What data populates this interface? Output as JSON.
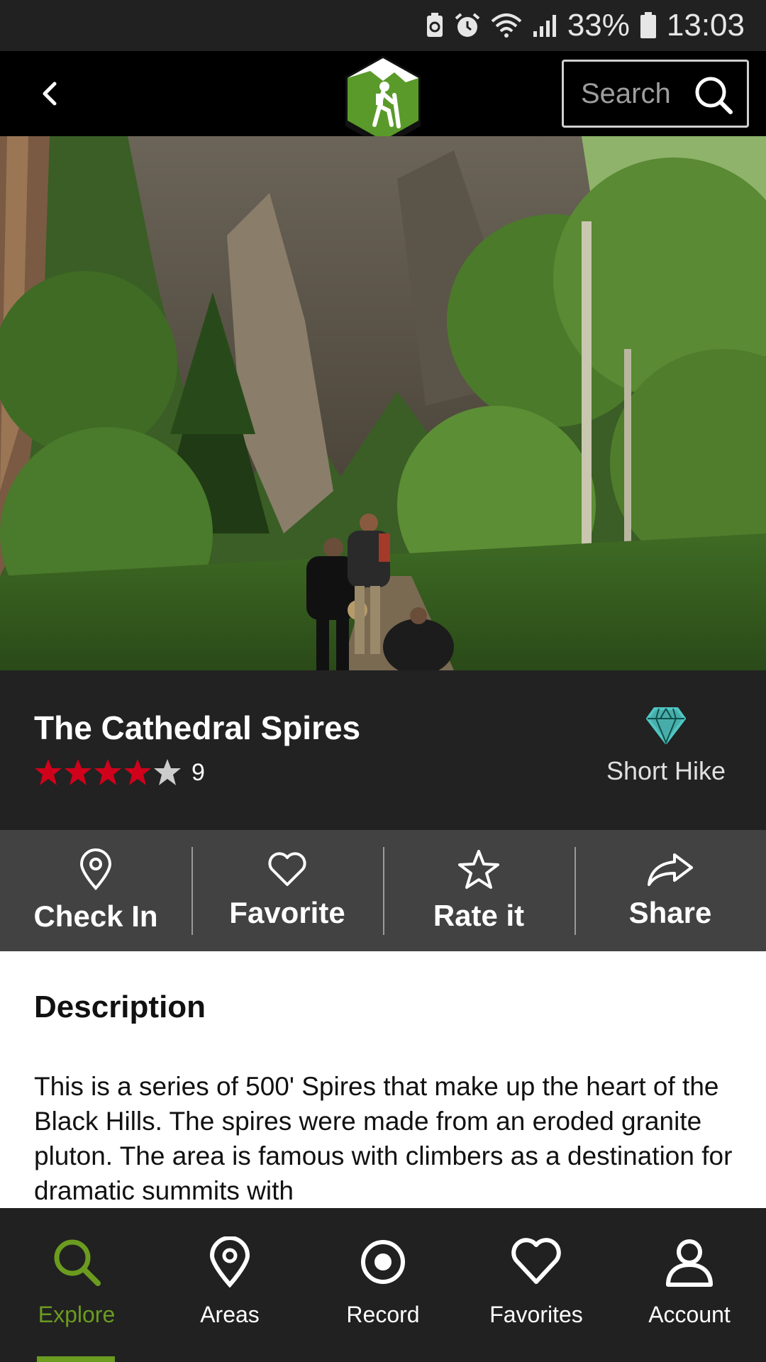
{
  "status_bar": {
    "battery": "33%",
    "time": "13:03"
  },
  "header": {
    "search_label": "Search"
  },
  "trail": {
    "title": "The Cathedral Spires",
    "rating": 4,
    "rating_max": 5,
    "rating_count": "9",
    "difficulty_label": "Short Hike"
  },
  "actions": [
    {
      "label": "Check In",
      "icon": "map-pin-icon"
    },
    {
      "label": "Favorite",
      "icon": "heart-icon"
    },
    {
      "label": "Rate it",
      "icon": "star-icon"
    },
    {
      "label": "Share",
      "icon": "share-arrow-icon"
    }
  ],
  "description": {
    "heading": "Description",
    "text": "This is a series of 500' Spires that make up the heart of the Black Hills. The spires were made from an eroded granite pluton. The area is famous with climbers as a destination for dramatic summits with"
  },
  "bottom_nav": {
    "items": [
      {
        "label": "Explore",
        "icon": "search-icon",
        "active": true
      },
      {
        "label": "Areas",
        "icon": "map-pin-icon",
        "active": false
      },
      {
        "label": "Record",
        "icon": "record-icon",
        "active": false
      },
      {
        "label": "Favorites",
        "icon": "heart-icon",
        "active": false
      },
      {
        "label": "Account",
        "icon": "person-icon",
        "active": false
      }
    ]
  },
  "colors": {
    "accent": "#6b9b1f",
    "star_filled": "#d0021b",
    "star_empty": "#cccccc",
    "diamond": "#4fc6c2"
  }
}
